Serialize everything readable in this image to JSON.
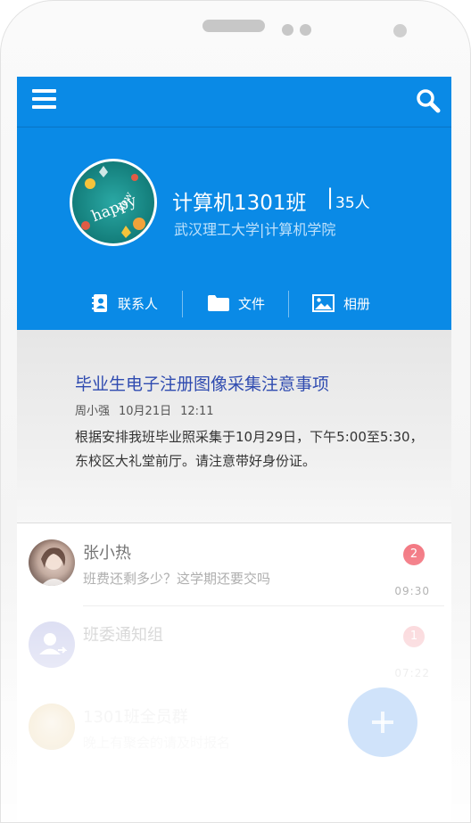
{
  "header": {
    "class_name": "计算机1301班",
    "separator": "|",
    "member_count": "35人",
    "school": "武汉理工大学|计算机学院",
    "avatar_text": "happy new"
  },
  "tabs": [
    {
      "label": "联系人",
      "icon": "contacts-icon"
    },
    {
      "label": "文件",
      "icon": "folder-icon"
    },
    {
      "label": "相册",
      "icon": "photo-icon"
    }
  ],
  "notice": {
    "title": "毕业生电子注册图像采集注意事项",
    "author": "周小强",
    "date": "10月21日",
    "time": "12:11",
    "body": "根据安排我班毕业照采集于10月29日，下午5:00至5:30，东校区大礼堂前厅。请注意带好身份证。"
  },
  "chats": [
    {
      "name": "张小热",
      "message": "班费还剩多少？这学期还要交吗",
      "time": "09:30",
      "badge": "2"
    },
    {
      "name": "班委通知组",
      "message": "",
      "time": "07:22",
      "badge": "1"
    },
    {
      "name": "1301班全员群",
      "message": "晚上有聚会的请及时报名",
      "time": "",
      "badge": ""
    }
  ],
  "colors": {
    "primary": "#0a8ae6",
    "notice_title": "#2f4bb0",
    "badge": "#f26f7a"
  }
}
